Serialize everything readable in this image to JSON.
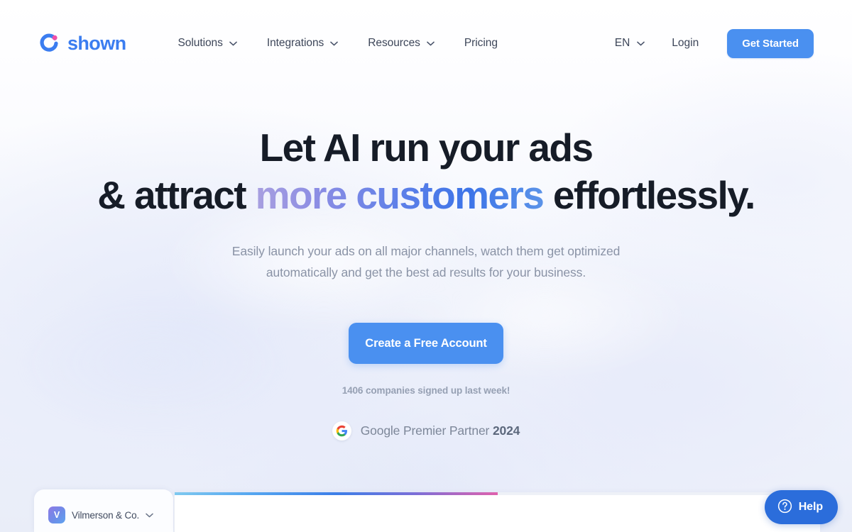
{
  "brand": {
    "name": "shown",
    "logo_icon": "shown-circle-dot-logo",
    "primary_color": "#3b7df0",
    "accent_color": "#e85aa8"
  },
  "header": {
    "nav": [
      {
        "label": "Solutions",
        "has_dropdown": true,
        "icon": "chevron-down-icon"
      },
      {
        "label": "Integrations",
        "has_dropdown": true,
        "icon": "chevron-down-icon"
      },
      {
        "label": "Resources",
        "has_dropdown": true,
        "icon": "chevron-down-icon"
      },
      {
        "label": "Pricing",
        "has_dropdown": false,
        "icon": ""
      }
    ],
    "language": {
      "label": "EN",
      "icon": "chevron-down-icon"
    },
    "login_label": "Login",
    "cta_label": "Get Started",
    "cta_color": "#4a90f0"
  },
  "hero": {
    "headline_line1": "Let AI run your ads",
    "headline_line2_pre": "& attract ",
    "headline_line2_highlight": "more customers",
    "headline_line2_post": " effortlessly.",
    "highlight_gradient_from": "#a89fe0",
    "highlight_gradient_to": "#3d74e8",
    "subhead_line1": "Easily launch your ads on all major channels, watch them get optimized",
    "subhead_line2": "automatically and get the best ad results for your business.",
    "cta_label": "Create a Free Account",
    "signup_note": "1406 companies signed up last week!",
    "partner": {
      "icon": "google-g-icon",
      "text": "Google Premier Partner ",
      "year": "2024"
    }
  },
  "dashboard_preview": {
    "org_initial": "V",
    "org_name": "Vilmerson & Co.",
    "org_dropdown_icon": "chevron-down-icon",
    "progress_gradient": [
      "#7fc9ef",
      "#3d7fe8",
      "#df62ad"
    ]
  },
  "help_widget": {
    "label": "Help",
    "icon": "question-circle-icon",
    "color": "#2b6ddb"
  }
}
